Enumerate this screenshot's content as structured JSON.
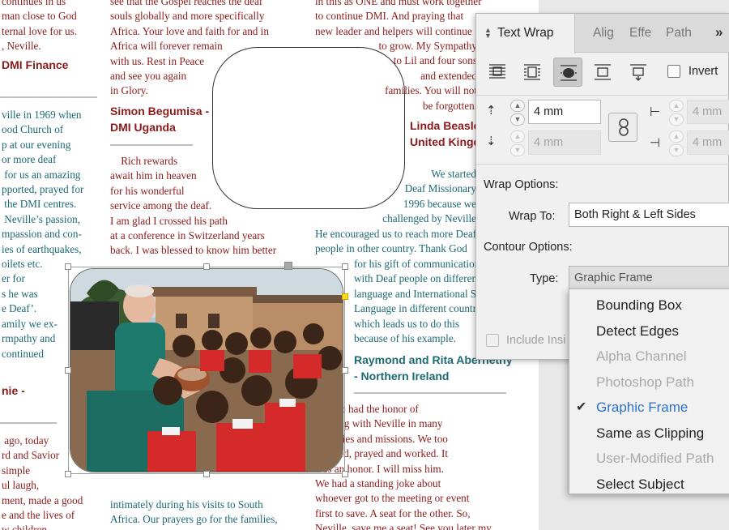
{
  "document": {
    "col1": [
      {
        "t": "continues in us",
        "c": "red"
      },
      {
        "t": "man close to God",
        "c": "red"
      },
      {
        "t": "ternal love for us.",
        "c": "red"
      },
      {
        "t": ", Neville.",
        "c": "red"
      }
    ],
    "col1_head1": [
      "DMI Finance"
    ],
    "col1_b": [
      {
        "t": "ville in 1969 when",
        "c": "teal"
      },
      {
        "t": "ood Church of",
        "c": "teal"
      },
      {
        "t": "p at our evening",
        "c": "teal"
      },
      {
        "t": "or more deaf",
        "c": "teal"
      },
      {
        "t": " for us an amazing",
        "c": "teal"
      },
      {
        "t": "pported, prayed for",
        "c": "teal"
      },
      {
        "t": " the DMI centres.",
        "c": "teal"
      },
      {
        "t": " Neville’s passion,",
        "c": "teal"
      },
      {
        "t": "mpassion and con-",
        "c": "teal"
      },
      {
        "t": "ies of earthquakes,",
        "c": "teal"
      },
      {
        "t": "oilets etc.",
        "c": "teal"
      },
      {
        "t": "er for",
        "c": "teal"
      },
      {
        "t": "s he was",
        "c": "teal"
      },
      {
        "t": "e Deaf’.",
        "c": "teal"
      },
      {
        "t": "amily we ex-",
        "c": "teal"
      },
      {
        "t": "rmpathy and",
        "c": "teal"
      },
      {
        "t": "continued",
        "c": "teal"
      }
    ],
    "col1_head2": [
      "nie -"
    ],
    "col1_c": [
      {
        "t": " ago, today",
        "c": "red"
      },
      {
        "t": "rd and Savior",
        "c": "red"
      },
      {
        "t": "simple",
        "c": "red"
      },
      {
        "t": "ul laugh,",
        "c": "red"
      },
      {
        "t": "ment, made a good",
        "c": "red"
      },
      {
        "t": "e and the lives of",
        "c": "red"
      },
      {
        "t": "w children",
        "c": "red"
      }
    ],
    "col2_a": [
      {
        "t": "see that the Gospel reaches the deaf",
        "c": "red"
      },
      {
        "t": "souls globally and more specifically",
        "c": "red"
      },
      {
        "t": "Africa. Your love and faith for and in",
        "c": "red"
      },
      {
        "t": "Africa will forever remain",
        "c": "red"
      },
      {
        "t": "with us. Rest in Peace",
        "c": "red"
      },
      {
        "t": "and see you again",
        "c": "red"
      },
      {
        "t": "in Glory.",
        "c": "red"
      }
    ],
    "col2_head": [
      "Simon Begumisa -",
      "DMI Uganda"
    ],
    "col2_b": [
      {
        "t": "    Rich rewards",
        "c": "red"
      },
      {
        "t": "await him in heaven",
        "c": "red"
      },
      {
        "t": "for his wonderful",
        "c": "red"
      },
      {
        "t": "service among the deaf.",
        "c": "red"
      },
      {
        "t": "I am glad I crossed his path",
        "c": "red"
      },
      {
        "t": "at a conference in Switzerland years",
        "c": "red"
      },
      {
        "t": "back. I was blessed to know him better",
        "c": "red"
      }
    ],
    "col2_c": [
      {
        "t": "intimately during his visits to South",
        "c": "teal"
      },
      {
        "t": "Africa. Our prayers go for the families,",
        "c": "teal"
      }
    ],
    "col3_a": [
      {
        "t": "in this as ONE and must work together",
        "c": "red"
      },
      {
        "t": "to continue DMI. And praying that",
        "c": "red"
      },
      {
        "t": "new leader and helpers will continue",
        "c": "red"
      }
    ],
    "col3_a2": [
      {
        "t": "to grow. My Sympathy",
        "c": "red"
      },
      {
        "t": "to Lil and four sons",
        "c": "red"
      },
      {
        "t": "and extended",
        "c": "red"
      },
      {
        "t": "families. You will not",
        "c": "red"
      },
      {
        "t": "be forgotten.",
        "c": "red"
      }
    ],
    "col3_head1": [
      "Linda Beasley -",
      "United Kingdom"
    ],
    "col3_b": [
      {
        "t": "We started",
        "c": "teal"
      },
      {
        "t": "Deaf Missionary",
        "c": "teal"
      },
      {
        "t": "1996 because we",
        "c": "teal"
      },
      {
        "t": "challenged by Neville",
        "c": "teal"
      }
    ],
    "col3_b2": [
      {
        "t": "He encouraged us to reach more Deaf",
        "c": "teal"
      },
      {
        "t": "people in other country. Thank God",
        "c": "teal"
      }
    ],
    "col3_b3": [
      {
        "t": "for his gift of communication",
        "c": "teal"
      },
      {
        "t": "with Deaf people on different",
        "c": "teal"
      },
      {
        "t": "language and International Sign",
        "c": "teal"
      },
      {
        "t": "Language in different countries",
        "c": "teal"
      },
      {
        "t": "which leads us to do this",
        "c": "teal"
      },
      {
        "t": "because of his example.",
        "c": "teal"
      }
    ],
    "col3_head2": [
      "Raymond and Rita Abernethy",
      "- Northern Ireland"
    ],
    "col3_c": [
      {
        "t": "    I too had the honor of",
        "c": "red"
      },
      {
        "t": "walking with Neville in many",
        "c": "red"
      },
      {
        "t": "countries and missions. We too",
        "c": "red"
      },
      {
        "t": "laughed, prayed and worked. It",
        "c": "red"
      },
      {
        "t": "was an honor. I will miss him.",
        "c": "red"
      },
      {
        "t": "We had a standing joke about",
        "c": "red"
      },
      {
        "t": "whoever got to the meeting or event",
        "c": "red"
      },
      {
        "t": "first to save. A seat for the other. So,",
        "c": "red"
      },
      {
        "t": "Neville, save me a seat! See you later my",
        "c": "red"
      }
    ]
  },
  "panel": {
    "tabs": [
      "Text Wrap",
      "Alig",
      "Effe",
      "Path"
    ],
    "more": "»",
    "invert_label": "Invert",
    "top_offset": "4 mm",
    "left_offset": "4 mm",
    "bottom_offset": "4 mm",
    "right_offset": "4 mm",
    "wrap_options_label": "Wrap Options:",
    "wrap_to_label": "Wrap To:",
    "wrap_to_value": "Both Right & Left Sides",
    "contour_options_label": "Contour Options:",
    "type_label": "Type:",
    "type_value": "Graphic Frame",
    "include_label": "Include Insi"
  },
  "dropdown": {
    "items": [
      {
        "label": "Bounding Box",
        "state": "enabled"
      },
      {
        "label": "Detect Edges",
        "state": "enabled"
      },
      {
        "label": "Alpha Channel",
        "state": "disabled"
      },
      {
        "label": "Photoshop Path",
        "state": "disabled"
      },
      {
        "label": "Graphic Frame",
        "state": "selected"
      },
      {
        "label": "Same as Clipping",
        "state": "enabled"
      },
      {
        "label": "User-Modified Path",
        "state": "disabled"
      },
      {
        "label": "Select Subject",
        "state": "enabled"
      }
    ],
    "check": "✔"
  },
  "colors": {
    "red_text": "#8c1a1a",
    "teal_text": "#1c6a73",
    "selection_blue": "#2a73c9"
  }
}
